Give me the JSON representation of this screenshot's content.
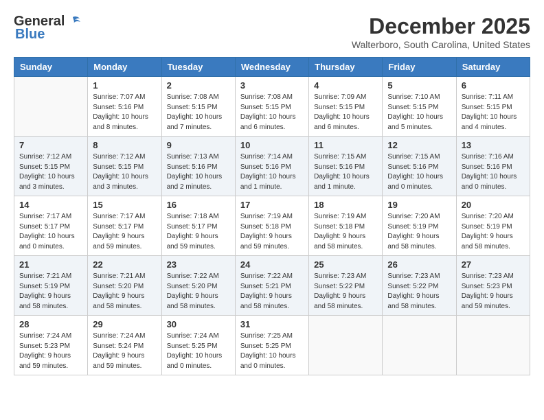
{
  "header": {
    "logo_general": "General",
    "logo_blue": "Blue",
    "month_year": "December 2025",
    "location": "Walterboro, South Carolina, United States"
  },
  "weekdays": [
    "Sunday",
    "Monday",
    "Tuesday",
    "Wednesday",
    "Thursday",
    "Friday",
    "Saturday"
  ],
  "weeks": [
    [
      {
        "day": "",
        "sunrise": "",
        "sunset": "",
        "daylight": ""
      },
      {
        "day": "1",
        "sunrise": "Sunrise: 7:07 AM",
        "sunset": "Sunset: 5:16 PM",
        "daylight": "Daylight: 10 hours and 8 minutes."
      },
      {
        "day": "2",
        "sunrise": "Sunrise: 7:08 AM",
        "sunset": "Sunset: 5:15 PM",
        "daylight": "Daylight: 10 hours and 7 minutes."
      },
      {
        "day": "3",
        "sunrise": "Sunrise: 7:08 AM",
        "sunset": "Sunset: 5:15 PM",
        "daylight": "Daylight: 10 hours and 6 minutes."
      },
      {
        "day": "4",
        "sunrise": "Sunrise: 7:09 AM",
        "sunset": "Sunset: 5:15 PM",
        "daylight": "Daylight: 10 hours and 6 minutes."
      },
      {
        "day": "5",
        "sunrise": "Sunrise: 7:10 AM",
        "sunset": "Sunset: 5:15 PM",
        "daylight": "Daylight: 10 hours and 5 minutes."
      },
      {
        "day": "6",
        "sunrise": "Sunrise: 7:11 AM",
        "sunset": "Sunset: 5:15 PM",
        "daylight": "Daylight: 10 hours and 4 minutes."
      }
    ],
    [
      {
        "day": "7",
        "sunrise": "Sunrise: 7:12 AM",
        "sunset": "Sunset: 5:15 PM",
        "daylight": "Daylight: 10 hours and 3 minutes."
      },
      {
        "day": "8",
        "sunrise": "Sunrise: 7:12 AM",
        "sunset": "Sunset: 5:15 PM",
        "daylight": "Daylight: 10 hours and 3 minutes."
      },
      {
        "day": "9",
        "sunrise": "Sunrise: 7:13 AM",
        "sunset": "Sunset: 5:16 PM",
        "daylight": "Daylight: 10 hours and 2 minutes."
      },
      {
        "day": "10",
        "sunrise": "Sunrise: 7:14 AM",
        "sunset": "Sunset: 5:16 PM",
        "daylight": "Daylight: 10 hours and 1 minute."
      },
      {
        "day": "11",
        "sunrise": "Sunrise: 7:15 AM",
        "sunset": "Sunset: 5:16 PM",
        "daylight": "Daylight: 10 hours and 1 minute."
      },
      {
        "day": "12",
        "sunrise": "Sunrise: 7:15 AM",
        "sunset": "Sunset: 5:16 PM",
        "daylight": "Daylight: 10 hours and 0 minutes."
      },
      {
        "day": "13",
        "sunrise": "Sunrise: 7:16 AM",
        "sunset": "Sunset: 5:16 PM",
        "daylight": "Daylight: 10 hours and 0 minutes."
      }
    ],
    [
      {
        "day": "14",
        "sunrise": "Sunrise: 7:17 AM",
        "sunset": "Sunset: 5:17 PM",
        "daylight": "Daylight: 10 hours and 0 minutes."
      },
      {
        "day": "15",
        "sunrise": "Sunrise: 7:17 AM",
        "sunset": "Sunset: 5:17 PM",
        "daylight": "Daylight: 9 hours and 59 minutes."
      },
      {
        "day": "16",
        "sunrise": "Sunrise: 7:18 AM",
        "sunset": "Sunset: 5:17 PM",
        "daylight": "Daylight: 9 hours and 59 minutes."
      },
      {
        "day": "17",
        "sunrise": "Sunrise: 7:19 AM",
        "sunset": "Sunset: 5:18 PM",
        "daylight": "Daylight: 9 hours and 59 minutes."
      },
      {
        "day": "18",
        "sunrise": "Sunrise: 7:19 AM",
        "sunset": "Sunset: 5:18 PM",
        "daylight": "Daylight: 9 hours and 58 minutes."
      },
      {
        "day": "19",
        "sunrise": "Sunrise: 7:20 AM",
        "sunset": "Sunset: 5:19 PM",
        "daylight": "Daylight: 9 hours and 58 minutes."
      },
      {
        "day": "20",
        "sunrise": "Sunrise: 7:20 AM",
        "sunset": "Sunset: 5:19 PM",
        "daylight": "Daylight: 9 hours and 58 minutes."
      }
    ],
    [
      {
        "day": "21",
        "sunrise": "Sunrise: 7:21 AM",
        "sunset": "Sunset: 5:19 PM",
        "daylight": "Daylight: 9 hours and 58 minutes."
      },
      {
        "day": "22",
        "sunrise": "Sunrise: 7:21 AM",
        "sunset": "Sunset: 5:20 PM",
        "daylight": "Daylight: 9 hours and 58 minutes."
      },
      {
        "day": "23",
        "sunrise": "Sunrise: 7:22 AM",
        "sunset": "Sunset: 5:20 PM",
        "daylight": "Daylight: 9 hours and 58 minutes."
      },
      {
        "day": "24",
        "sunrise": "Sunrise: 7:22 AM",
        "sunset": "Sunset: 5:21 PM",
        "daylight": "Daylight: 9 hours and 58 minutes."
      },
      {
        "day": "25",
        "sunrise": "Sunrise: 7:23 AM",
        "sunset": "Sunset: 5:22 PM",
        "daylight": "Daylight: 9 hours and 58 minutes."
      },
      {
        "day": "26",
        "sunrise": "Sunrise: 7:23 AM",
        "sunset": "Sunset: 5:22 PM",
        "daylight": "Daylight: 9 hours and 58 minutes."
      },
      {
        "day": "27",
        "sunrise": "Sunrise: 7:23 AM",
        "sunset": "Sunset: 5:23 PM",
        "daylight": "Daylight: 9 hours and 59 minutes."
      }
    ],
    [
      {
        "day": "28",
        "sunrise": "Sunrise: 7:24 AM",
        "sunset": "Sunset: 5:23 PM",
        "daylight": "Daylight: 9 hours and 59 minutes."
      },
      {
        "day": "29",
        "sunrise": "Sunrise: 7:24 AM",
        "sunset": "Sunset: 5:24 PM",
        "daylight": "Daylight: 9 hours and 59 minutes."
      },
      {
        "day": "30",
        "sunrise": "Sunrise: 7:24 AM",
        "sunset": "Sunset: 5:25 PM",
        "daylight": "Daylight: 10 hours and 0 minutes."
      },
      {
        "day": "31",
        "sunrise": "Sunrise: 7:25 AM",
        "sunset": "Sunset: 5:25 PM",
        "daylight": "Daylight: 10 hours and 0 minutes."
      },
      {
        "day": "",
        "sunrise": "",
        "sunset": "",
        "daylight": ""
      },
      {
        "day": "",
        "sunrise": "",
        "sunset": "",
        "daylight": ""
      },
      {
        "day": "",
        "sunrise": "",
        "sunset": "",
        "daylight": ""
      }
    ]
  ]
}
